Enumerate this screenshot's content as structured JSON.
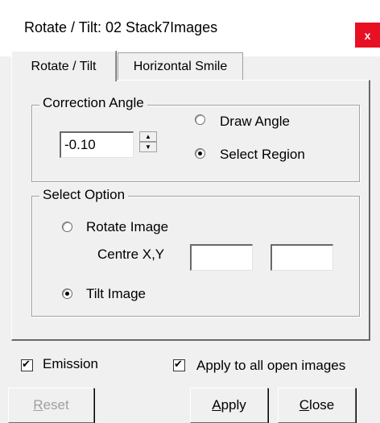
{
  "window": {
    "title": "Rotate / Tilt: 02 Stack7Images",
    "close_label": "x"
  },
  "tabs": [
    {
      "label": "Rotate / Tilt",
      "active": true
    },
    {
      "label": "Horizontal Smile",
      "active": false
    }
  ],
  "correction_angle": {
    "legend": "Correction Angle",
    "value": "-0.10",
    "options": [
      {
        "label": "Draw Angle",
        "checked": false
      },
      {
        "label": "Select Region",
        "checked": true
      }
    ]
  },
  "select_option": {
    "legend": "Select Option",
    "rotate_label": "Rotate Image",
    "centre_label": "Centre X,Y",
    "centre_x": "",
    "centre_y": "",
    "tilt_label": "Tilt Image",
    "rotate_checked": false,
    "tilt_checked": true
  },
  "footer": {
    "emission_label": "Emission",
    "emission_checked": true,
    "apply_all_label": "Apply to all open images",
    "apply_all_checked": true
  },
  "buttons": {
    "reset_first": "R",
    "reset_rest": "eset",
    "apply_first": "A",
    "apply_rest": "pply",
    "close_first": "C",
    "close_rest": "lose"
  }
}
